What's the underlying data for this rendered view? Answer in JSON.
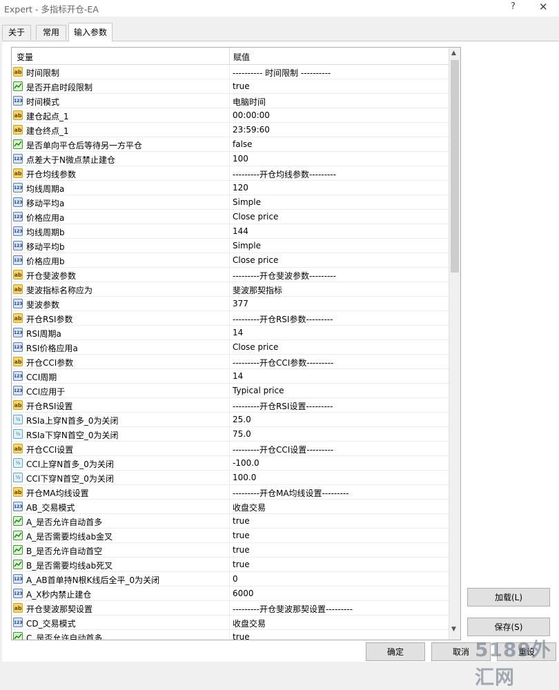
{
  "window": {
    "title": "Expert - 多指标开仓-EA",
    "help_label": "?",
    "close_label": "✕"
  },
  "tabs": [
    {
      "label": "关于"
    },
    {
      "label": "常用"
    },
    {
      "label": "输入参数"
    }
  ],
  "grid": {
    "col_variable": "变量",
    "col_value": "赋值",
    "rows": [
      {
        "icon": "ab",
        "name": "时间限制",
        "value": "---------- 时间限制 ----------"
      },
      {
        "icon": "bool",
        "name": "是否开启时段限制",
        "value": "true"
      },
      {
        "icon": "num",
        "name": "时间模式",
        "value": "电脑时间"
      },
      {
        "icon": "ab",
        "name": "建仓起点_1",
        "value": "00:00:00"
      },
      {
        "icon": "ab",
        "name": "建仓终点_1",
        "value": "23:59:60"
      },
      {
        "icon": "bool",
        "name": "是否单向平仓后等待另一方平仓",
        "value": "false"
      },
      {
        "icon": "num",
        "name": "点差大于N微点禁止建仓",
        "value": "100"
      },
      {
        "icon": "ab",
        "name": "开仓均线参数",
        "value": "---------开仓均线参数---------"
      },
      {
        "icon": "num",
        "name": "均线周期a",
        "value": "120"
      },
      {
        "icon": "num",
        "name": "移动平均a",
        "value": "Simple"
      },
      {
        "icon": "num",
        "name": "价格应用a",
        "value": "Close price"
      },
      {
        "icon": "num",
        "name": "均线周期b",
        "value": "144"
      },
      {
        "icon": "num",
        "name": "移动平均b",
        "value": "Simple"
      },
      {
        "icon": "num",
        "name": "价格应用b",
        "value": "Close price"
      },
      {
        "icon": "ab",
        "name": "开仓斐波参数",
        "value": "---------开仓斐波参数---------"
      },
      {
        "icon": "ab",
        "name": "斐波指标名称应为",
        "value": "斐波那契指标"
      },
      {
        "icon": "num",
        "name": "斐波参数",
        "value": "377"
      },
      {
        "icon": "ab",
        "name": "开仓RSI参数",
        "value": "---------开仓RSI参数---------"
      },
      {
        "icon": "num",
        "name": "RSI周期a",
        "value": "14"
      },
      {
        "icon": "num",
        "name": "RSI价格应用a",
        "value": "Close price"
      },
      {
        "icon": "ab",
        "name": "开仓CCI参数",
        "value": "---------开仓CCI参数---------"
      },
      {
        "icon": "num",
        "name": "CCI周期",
        "value": "14"
      },
      {
        "icon": "num",
        "name": "CCI应用于",
        "value": "Typical price"
      },
      {
        "icon": "ab",
        "name": "开仓RSI设置",
        "value": "---------开仓RSI设置---------"
      },
      {
        "icon": "half",
        "name": "RSIa上穿N首多_0为关闭",
        "value": "25.0"
      },
      {
        "icon": "half",
        "name": "RSIa下穿N首空_0为关闭",
        "value": "75.0"
      },
      {
        "icon": "ab",
        "name": "开仓CCI设置",
        "value": "---------开仓CCI设置---------"
      },
      {
        "icon": "half",
        "name": "CCI上穿N首多_0为关闭",
        "value": "-100.0"
      },
      {
        "icon": "half",
        "name": "CCI下穿N首空_0为关闭",
        "value": "100.0"
      },
      {
        "icon": "ab",
        "name": "开仓MA均线设置",
        "value": "---------开仓MA均线设置---------"
      },
      {
        "icon": "num",
        "name": "AB_交易模式",
        "value": "收盘交易"
      },
      {
        "icon": "bool",
        "name": "A_是否允许自动首多",
        "value": "true"
      },
      {
        "icon": "bool",
        "name": "A_是否需要均线ab金叉",
        "value": "true"
      },
      {
        "icon": "bool",
        "name": "B_是否允许自动首空",
        "value": "true"
      },
      {
        "icon": "bool",
        "name": "B_是否需要均线ab死叉",
        "value": "true"
      },
      {
        "icon": "num",
        "name": "A_AB首单持N根K线后全平_0为关闭",
        "value": "0"
      },
      {
        "icon": "num",
        "name": "A_X秒内禁止建仓",
        "value": "6000"
      },
      {
        "icon": "ab",
        "name": "开仓斐波那契设置",
        "value": "---------开仓斐波那契设置---------"
      },
      {
        "icon": "num",
        "name": "CD_交易模式",
        "value": "收盘交易"
      },
      {
        "icon": "bool",
        "name": "C_是否允许自动首多",
        "value": "true"
      }
    ]
  },
  "side_buttons": {
    "load": "加载(L)",
    "save": "保存(S)"
  },
  "bottom_buttons": {
    "ok": "确定",
    "cancel": "取消",
    "reset": "重设"
  },
  "watermark": "5189外汇网"
}
